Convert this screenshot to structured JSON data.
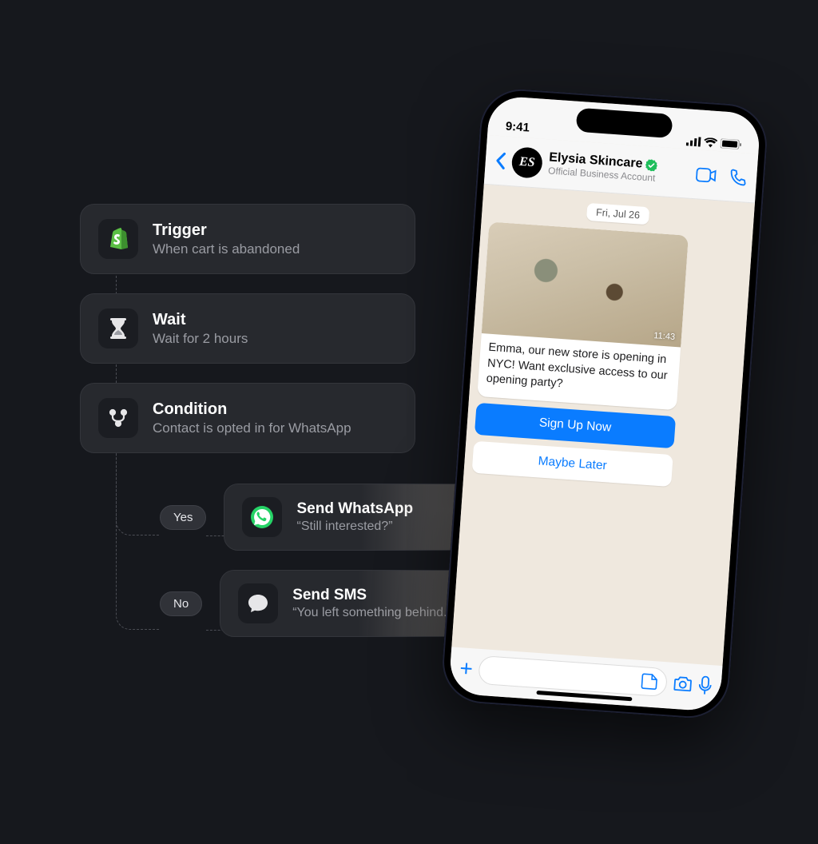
{
  "flow": {
    "nodes": [
      {
        "icon": "shopify",
        "title": "Trigger",
        "sub": "When cart is abandoned"
      },
      {
        "icon": "hourglass",
        "title": "Wait",
        "sub": "Wait for 2 hours"
      },
      {
        "icon": "branch",
        "title": "Condition",
        "sub": "Contact is opted in for WhatsApp"
      }
    ],
    "branches": [
      {
        "label": "Yes",
        "icon": "whatsapp",
        "title": "Send WhatsApp",
        "sub": "“Still interested?”"
      },
      {
        "label": "No",
        "icon": "sms",
        "title": "Send SMS",
        "sub": "“You left something behind.”"
      }
    ]
  },
  "phone": {
    "status_time": "9:41",
    "contact_name": "Elysia Skincare",
    "contact_subtype": "Official Business Account",
    "avatar_initials": "ES",
    "date_label": "Fri, Jul 26",
    "message_text": "Emma, our new store is opening in NYC! Want exclusive access to our opening party?",
    "message_time": "11:43",
    "cta_primary": "Sign Up Now",
    "cta_secondary": "Maybe Later"
  },
  "colors": {
    "shopify": "#5bbf45",
    "whatsapp": "#25d366",
    "ios_blue": "#0a7cff"
  }
}
